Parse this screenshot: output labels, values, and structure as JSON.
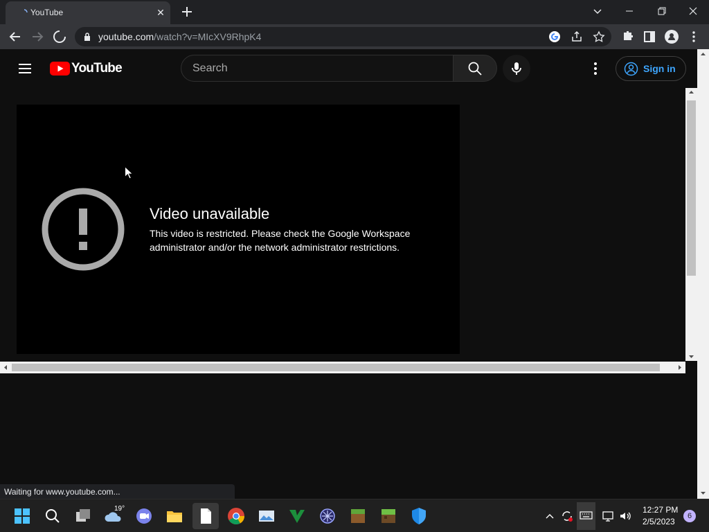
{
  "browser": {
    "tab_title": "YouTube",
    "new_tab_label": "+",
    "url_domain": "youtube.com",
    "url_path": "/watch?v=MIcXV9RhpK4",
    "status_text": "Waiting for www.youtube.com..."
  },
  "youtube": {
    "logo_text": "YouTube",
    "search_placeholder": "Search",
    "signin_label": "Sign in"
  },
  "player": {
    "error_title": "Video unavailable",
    "error_message": "This video is restricted. Please check the Google Workspace administrator and/or the network administrator restrictions."
  },
  "taskbar": {
    "weather_temp": "19°",
    "clock_time": "12:27 PM",
    "clock_date": "2/5/2023",
    "notification_count": "6"
  },
  "colors": {
    "accent_blue": "#3ea6ff",
    "youtube_red": "#ff0000",
    "page_bg": "#0f0f0f"
  }
}
